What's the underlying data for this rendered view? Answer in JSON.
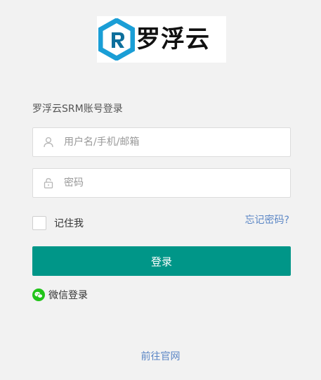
{
  "logo": {
    "text": "罗浮云",
    "icon": "logo-mark-icon",
    "colors": {
      "mark_primary": "#1a9ed6",
      "mark_dark": "#0d6f9c",
      "text": "#111111"
    }
  },
  "login": {
    "title": "罗浮云SRM账号登录",
    "username": {
      "placeholder": "用户名/手机/邮箱",
      "value": "",
      "icon": "user-icon"
    },
    "password": {
      "placeholder": "密码",
      "value": "",
      "icon": "lock-icon"
    },
    "remember_label": "记住我",
    "remember_checked": false,
    "forgot_label": "忘记密码?",
    "submit_label": "登录",
    "wechat_label": "微信登录",
    "wechat_icon": "wechat-icon",
    "official_site_label": "前往官网"
  },
  "colors": {
    "primary": "#009688",
    "link": "#5b86c5",
    "background": "#f2f2f2",
    "wechat": "#22c41a"
  }
}
